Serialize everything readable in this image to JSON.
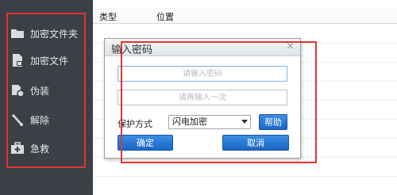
{
  "sidebar": {
    "items": [
      {
        "label": "加密文件夹",
        "icon": "folder-icon"
      },
      {
        "label": "加密文件",
        "icon": "file-lock-icon"
      },
      {
        "label": "伪装",
        "icon": "disguise-icon"
      },
      {
        "label": "解除",
        "icon": "unlock-icon"
      },
      {
        "label": "急救",
        "icon": "first-aid-icon"
      }
    ]
  },
  "table": {
    "columns": [
      "类型",
      "位置"
    ]
  },
  "dialog": {
    "title": "输入密码",
    "close_glyph": "×",
    "password_placeholder": "请输入密码",
    "confirm_placeholder": "请再输入一次",
    "protect_label": "保护方式",
    "protect_value": "闪电加密",
    "help_label": "帮助",
    "ok_label": "确定",
    "cancel_label": "取消"
  },
  "colors": {
    "sidebar_bg": "#3c4046",
    "highlight": "#e0362e",
    "button_blue": "#1a66c6"
  }
}
